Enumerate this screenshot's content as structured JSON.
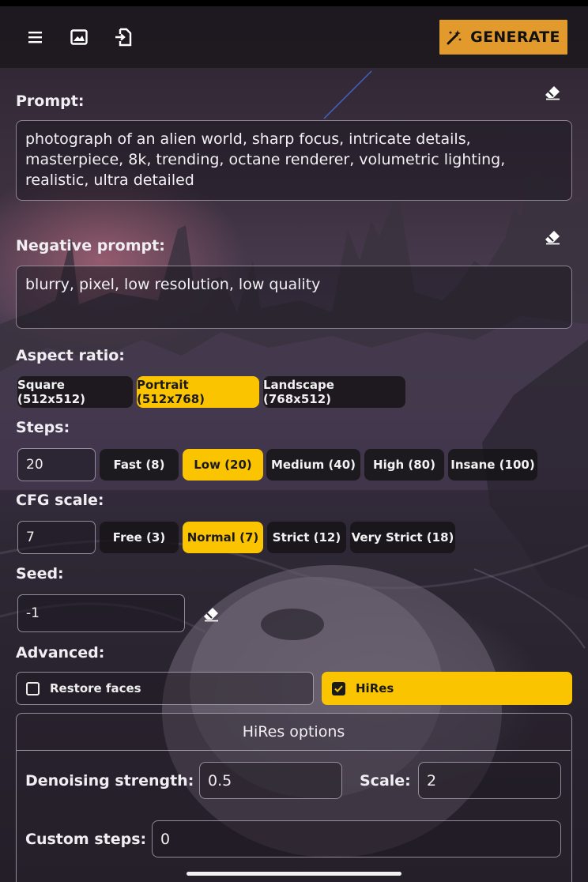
{
  "toolbar": {
    "menu_icon": "menu-icon",
    "gallery_icon": "image-icon",
    "import_icon": "import-icon",
    "generate_label": "GENERATE",
    "generate_icon": "magic-wand-icon"
  },
  "prompt": {
    "label": "Prompt:",
    "value": "photograph of an alien world, sharp focus, intricate details, masterpiece, 8k, trending, octane renderer, volumetric lighting, realistic, ultra detailed",
    "clear_icon": "eraser-icon"
  },
  "negative_prompt": {
    "label": "Negative prompt:",
    "value": "blurry, pixel, low resolution, low quality",
    "clear_icon": "eraser-icon"
  },
  "aspect_ratio": {
    "label": "Aspect ratio:",
    "options": [
      "Square (512x512)",
      "Portrait (512x768)",
      "Landscape (768x512)"
    ],
    "selected": "Portrait (512x768)"
  },
  "steps": {
    "label": "Steps:",
    "value": "20",
    "presets": [
      "Fast (8)",
      "Low (20)",
      "Medium (40)",
      "High (80)",
      "Insane (100)"
    ],
    "selected": "Low (20)"
  },
  "cfg_scale": {
    "label": "CFG scale:",
    "value": "7",
    "presets": [
      "Free (3)",
      "Normal (7)",
      "Strict (12)",
      "Very Strict (18)"
    ],
    "selected": "Normal (7)"
  },
  "seed": {
    "label": "Seed:",
    "value": "-1",
    "clear_icon": "eraser-icon"
  },
  "advanced": {
    "label": "Advanced:",
    "restore_faces": {
      "label": "Restore faces",
      "checked": false
    },
    "hires": {
      "label": "HiRes",
      "checked": true
    }
  },
  "hires_options": {
    "title": "HiRes options",
    "denoising_label": "Denoising strength:",
    "denoising_value": "0.5",
    "scale_label": "Scale:",
    "scale_value": "2",
    "custom_steps_label": "Custom steps:",
    "custom_steps_value": "0"
  },
  "colors": {
    "accent": "#fbc400",
    "generate_button": "#e39a2c",
    "chip_dark": "#161418"
  }
}
